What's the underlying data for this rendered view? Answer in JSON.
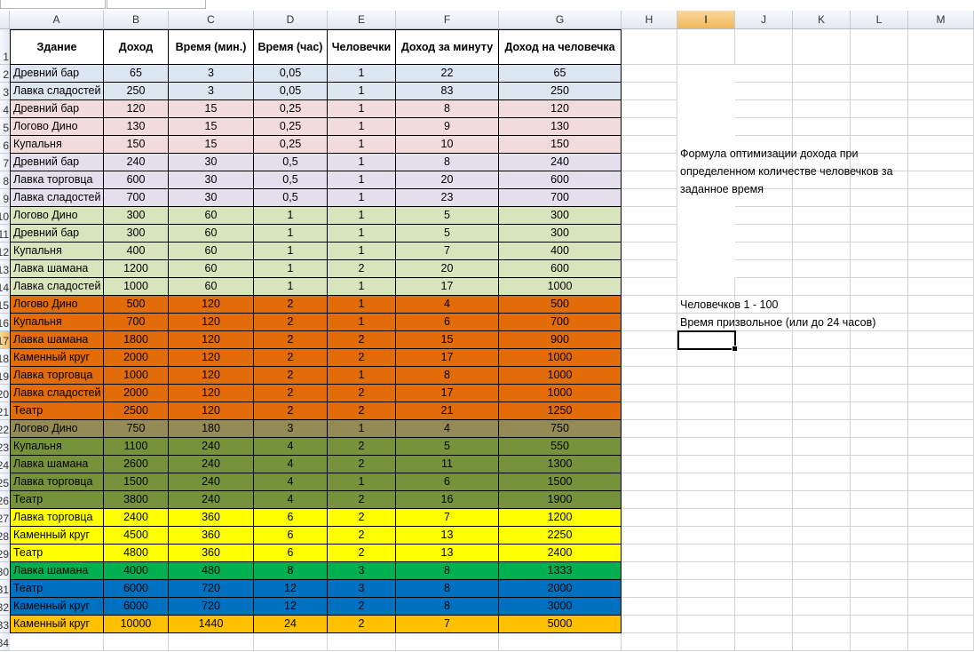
{
  "columns": [
    "A",
    "B",
    "C",
    "D",
    "E",
    "F",
    "G",
    "H",
    "I",
    "J",
    "K",
    "L",
    "M"
  ],
  "selected_column": "I",
  "selected_row": 17,
  "headers": [
    "Здание",
    "Доход",
    "Время (мин.)",
    "Время (час)",
    "Человечки",
    "Доход за минуту",
    "Доход на человечка"
  ],
  "rows": [
    {
      "n": 2,
      "fill": "#dce6f1",
      "cells": [
        "Древний бар",
        "65",
        "3",
        "0,05",
        "1",
        "22",
        "65"
      ]
    },
    {
      "n": 3,
      "fill": "#dce6f1",
      "cells": [
        "Лавка сладостей",
        "250",
        "3",
        "0,05",
        "1",
        "83",
        "250"
      ]
    },
    {
      "n": 4,
      "fill": "#f2dcdb",
      "cells": [
        "Древний бар",
        "120",
        "15",
        "0,25",
        "1",
        "8",
        "120"
      ]
    },
    {
      "n": 5,
      "fill": "#f2dcdb",
      "cells": [
        "Логово Дино",
        "130",
        "15",
        "0,25",
        "1",
        "9",
        "130"
      ]
    },
    {
      "n": 6,
      "fill": "#f2dcdb",
      "cells": [
        "Купальня",
        "150",
        "15",
        "0,25",
        "1",
        "10",
        "150"
      ]
    },
    {
      "n": 7,
      "fill": "#e4dfec",
      "cells": [
        "Древний бар",
        "240",
        "30",
        "0,5",
        "1",
        "8",
        "240"
      ]
    },
    {
      "n": 8,
      "fill": "#e4dfec",
      "cells": [
        "Лавка торговца",
        "600",
        "30",
        "0,5",
        "1",
        "20",
        "600"
      ]
    },
    {
      "n": 9,
      "fill": "#e4dfec",
      "cells": [
        "Лавка сладостей",
        "700",
        "30",
        "0,5",
        "1",
        "23",
        "700"
      ]
    },
    {
      "n": 10,
      "fill": "#d8e4bc",
      "cells": [
        "Логово Дино",
        "300",
        "60",
        "1",
        "1",
        "5",
        "300"
      ]
    },
    {
      "n": 11,
      "fill": "#d8e4bc",
      "cells": [
        "Древний бар",
        "300",
        "60",
        "1",
        "1",
        "5",
        "300"
      ]
    },
    {
      "n": 12,
      "fill": "#d8e4bc",
      "cells": [
        "Купальня",
        "400",
        "60",
        "1",
        "1",
        "7",
        "400"
      ]
    },
    {
      "n": 13,
      "fill": "#d8e4bc",
      "cells": [
        "Лавка шамана",
        "1200",
        "60",
        "1",
        "2",
        "20",
        "600"
      ]
    },
    {
      "n": 14,
      "fill": "#d8e4bc",
      "cells": [
        "Лавка сладостей",
        "1000",
        "60",
        "1",
        "1",
        "17",
        "1000"
      ]
    },
    {
      "n": 15,
      "fill": "#e26b0a",
      "cells": [
        "Логово Дино",
        "500",
        "120",
        "2",
        "1",
        "4",
        "500"
      ]
    },
    {
      "n": 16,
      "fill": "#e26b0a",
      "cells": [
        "Купальня",
        "700",
        "120",
        "2",
        "1",
        "6",
        "700"
      ]
    },
    {
      "n": 17,
      "fill": "#e26b0a",
      "cells": [
        "Лавка шамана",
        "1800",
        "120",
        "2",
        "2",
        "15",
        "900"
      ]
    },
    {
      "n": 18,
      "fill": "#e26b0a",
      "cells": [
        "Каменный круг",
        "2000",
        "120",
        "2",
        "2",
        "17",
        "1000"
      ]
    },
    {
      "n": 19,
      "fill": "#e26b0a",
      "cells": [
        "Лавка торговца",
        "1000",
        "120",
        "2",
        "1",
        "8",
        "1000"
      ]
    },
    {
      "n": 20,
      "fill": "#e26b0a",
      "cells": [
        "Лавка сладостей",
        "2000",
        "120",
        "2",
        "2",
        "17",
        "1000"
      ]
    },
    {
      "n": 21,
      "fill": "#e26b0a",
      "cells": [
        "Театр",
        "2500",
        "120",
        "2",
        "2",
        "21",
        "1250"
      ]
    },
    {
      "n": 22,
      "fill": "#948a54",
      "cells": [
        "Логово Дино",
        "750",
        "180",
        "3",
        "1",
        "4",
        "750"
      ]
    },
    {
      "n": 23,
      "fill": "#76933c",
      "cells": [
        "Купальня",
        "1100",
        "240",
        "4",
        "2",
        "5",
        "550"
      ]
    },
    {
      "n": 24,
      "fill": "#76933c",
      "cells": [
        "Лавка шамана",
        "2600",
        "240",
        "4",
        "2",
        "11",
        "1300"
      ]
    },
    {
      "n": 25,
      "fill": "#76933c",
      "cells": [
        "Лавка торговца",
        "1500",
        "240",
        "4",
        "1",
        "6",
        "1500"
      ]
    },
    {
      "n": 26,
      "fill": "#76933c",
      "cells": [
        "Театр",
        "3800",
        "240",
        "4",
        "2",
        "16",
        "1900"
      ]
    },
    {
      "n": 27,
      "fill": "#ffff00",
      "cells": [
        "Лавка торговца",
        "2400",
        "360",
        "6",
        "2",
        "7",
        "1200"
      ]
    },
    {
      "n": 28,
      "fill": "#ffff00",
      "cells": [
        "Каменный круг",
        "4500",
        "360",
        "6",
        "2",
        "13",
        "2250"
      ]
    },
    {
      "n": 29,
      "fill": "#ffff00",
      "cells": [
        "Театр",
        "4800",
        "360",
        "6",
        "2",
        "13",
        "2400"
      ]
    },
    {
      "n": 30,
      "fill": "#00b050",
      "cells": [
        "Лавка шамана",
        "4000",
        "480",
        "8",
        "3",
        "8",
        "1333"
      ]
    },
    {
      "n": 31,
      "fill": "#0070c0",
      "cells": [
        "Театр",
        "6000",
        "720",
        "12",
        "3",
        "8",
        "2000"
      ]
    },
    {
      "n": 32,
      "fill": "#0070c0",
      "cells": [
        "Каменный круг",
        "6000",
        "720",
        "12",
        "2",
        "8",
        "3000"
      ]
    },
    {
      "n": 33,
      "fill": "#ffc000",
      "cells": [
        "Каменный круг",
        "10000",
        "1440",
        "24",
        "2",
        "7",
        "5000"
      ]
    }
  ],
  "extra_row": 34,
  "notes": {
    "formula_line1": "Формула оптимизации дохода при",
    "formula_line2": "определенном количестве человечков за",
    "formula_line3": "заданное время",
    "people_range": "Человечков 1 - 100",
    "time_range": "Время призвольное (или до 24 часов)"
  }
}
